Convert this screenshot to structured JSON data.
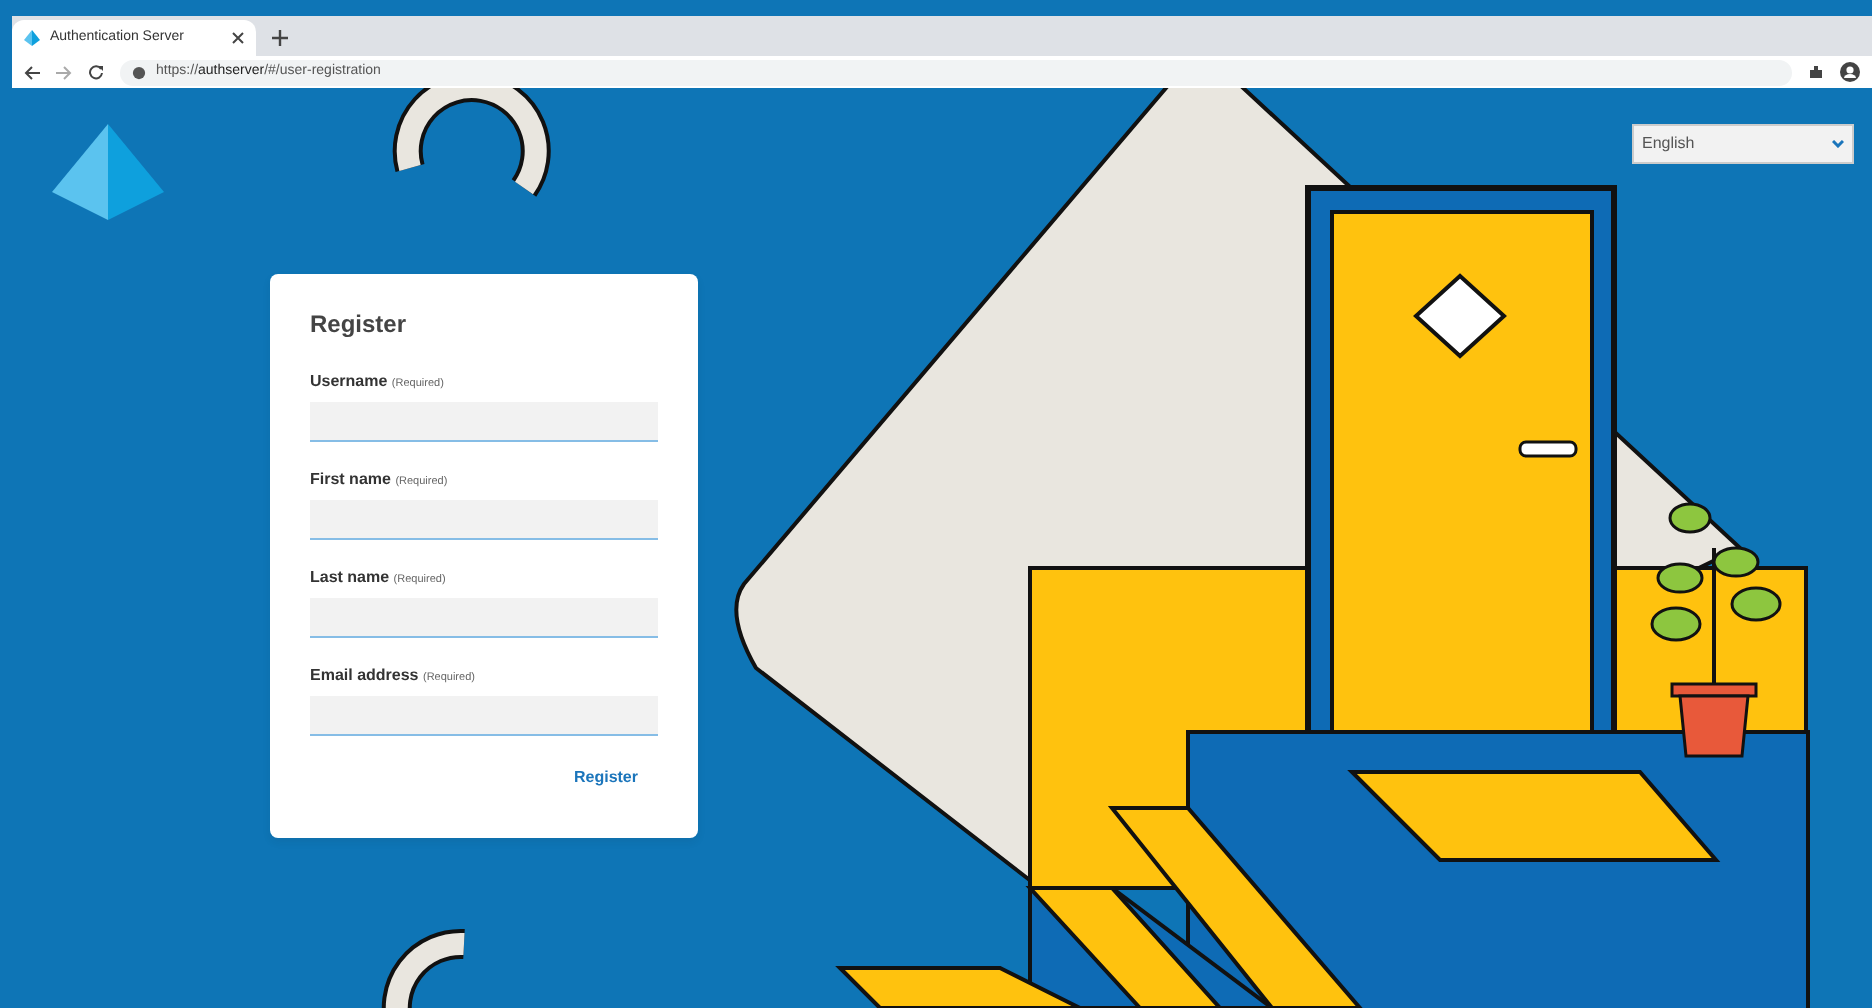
{
  "browser": {
    "tab_title": "Authentication Server",
    "url": "https://**authserver**/#/user-registration"
  },
  "language_select": {
    "value": "English"
  },
  "form": {
    "title": "Register",
    "fields": [
      {
        "label": "Username",
        "hint": "(Required)"
      },
      {
        "label": "First name",
        "hint": "(Required)"
      },
      {
        "label": "Last name",
        "hint": "(Required)"
      },
      {
        "label": "Email address",
        "hint": "(Required)"
      }
    ],
    "submit": "Register"
  }
}
